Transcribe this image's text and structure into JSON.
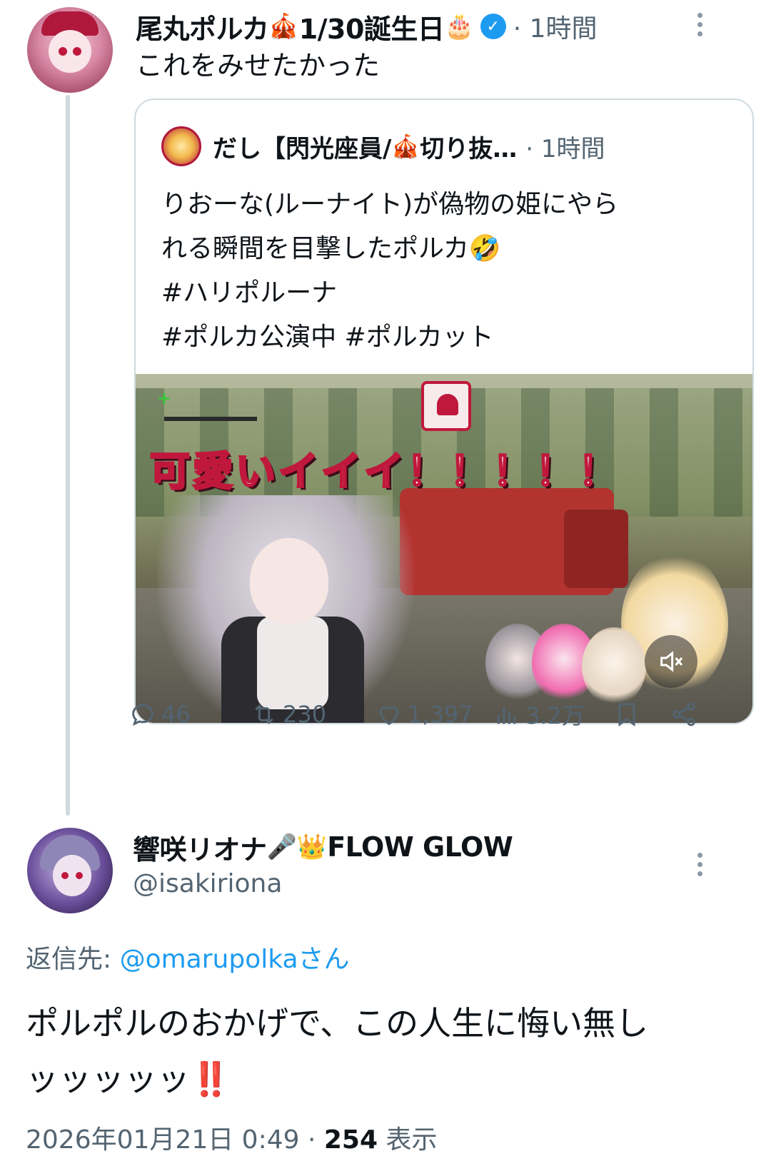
{
  "parent_tweet": {
    "display_name": "尾丸ポルカ",
    "name_emoji_1": "🎪",
    "name_suffix": "1/30誕生日",
    "name_emoji_2": "🎂",
    "verified_mark": "✓",
    "time": "· 1時間",
    "text": "これをみせたかった",
    "quote": {
      "display_name": "だし【閃光座員/",
      "name_emoji": "🎪",
      "name_tail": "切り抜…",
      "time": "· 1時間",
      "lines": [
        "りおーな(ルーナイト)が偽物の姫にやら",
        "れる瞬間を目撃したポルカ🤣",
        "#ハリポルーナ",
        "#ポルカ公演中 #ポルカット"
      ],
      "video_caption": "可愛いイイイ！！！！！",
      "mute_icon": "speaker-muted-icon"
    },
    "actions": {
      "reply_count": "46",
      "retweet_count": "230",
      "like_count": "1,397",
      "view_count": "3.2万"
    }
  },
  "reply_tweet": {
    "display_name": "響咲リオナ",
    "name_emoji_1": "🎤",
    "name_emoji_2": "👑",
    "name_suffix": "FLOW GLOW",
    "handle": "@isakiriona",
    "reply_to_label": "返信先: ",
    "reply_to_user": "@omarupolkaさん",
    "text_line_1": "ポルポルのおかげで、この人生に悔い無し",
    "text_line_2": "ッッッッッ",
    "text_bang": "‼️",
    "date": "2026年01月21日 0:49 · ",
    "views_count": "254",
    "views_label": " 表示"
  },
  "colors": {
    "accent": "#1d9bf0",
    "text": "#0f1419",
    "muted": "#536471",
    "border": "#cfd9de",
    "brand_red": "#c0183c"
  }
}
